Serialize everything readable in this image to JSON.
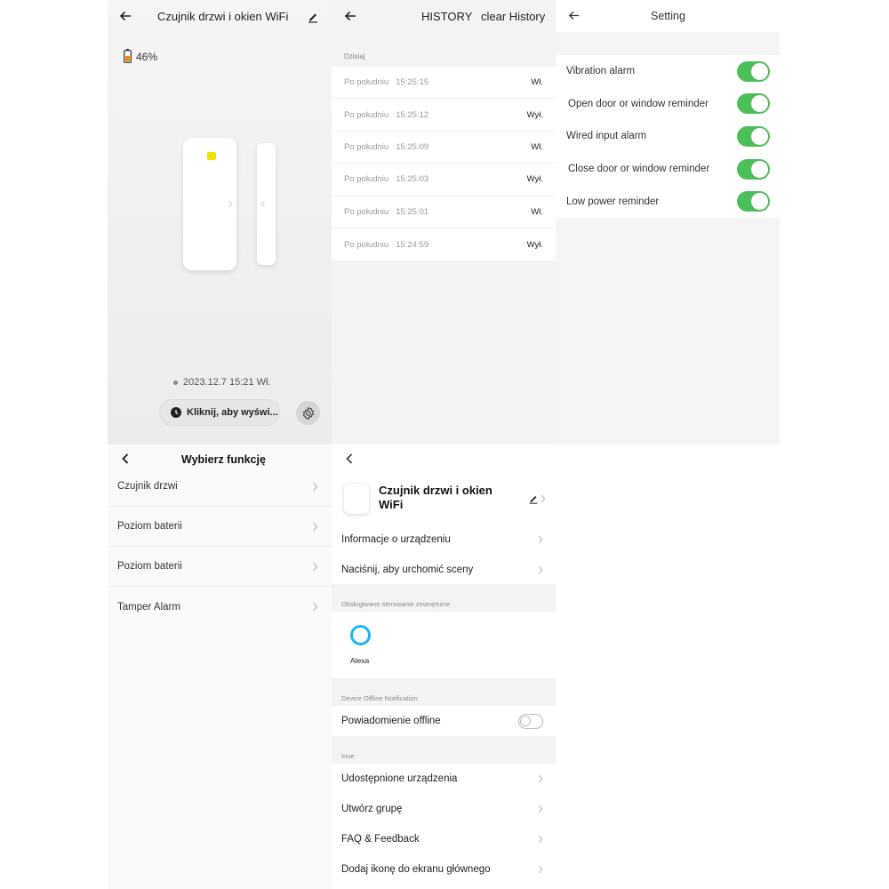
{
  "screen_device": {
    "title": "Czujnik drzwi i okien WiFi",
    "battery": "46%",
    "last_status": "2023.12.7 15:21 Wł.",
    "history_button": "Kliknij, aby wyświ..."
  },
  "screen_history": {
    "title": "HISTORY",
    "clear_label": "clear History",
    "section": "Dzisiaj",
    "records": [
      {
        "period": "Po południu",
        "time": "15:25:15",
        "state": "Wł."
      },
      {
        "period": "Po południu",
        "time": "15:25:12",
        "state": "Wył."
      },
      {
        "period": "Po południu",
        "time": "15:25:09",
        "state": "Wł."
      },
      {
        "period": "Po południu",
        "time": "15:25:03",
        "state": "Wył."
      },
      {
        "period": "Po południu",
        "time": "15:25:01",
        "state": "Wł."
      },
      {
        "period": "Po południu",
        "time": "15:24:59",
        "state": "Wył."
      }
    ]
  },
  "screen_setting": {
    "title": "Setting",
    "options": [
      {
        "label": "Vibration alarm",
        "enabled": true
      },
      {
        "label": "Open door or window reminder",
        "enabled": true
      },
      {
        "label": "Wired input alarm",
        "enabled": true
      },
      {
        "label": "Close door or window reminder",
        "enabled": true
      },
      {
        "label": "Low power reminder",
        "enabled": true
      }
    ]
  },
  "screen_functions": {
    "title": "Wybierz funkcję",
    "items": [
      "Czujnik drzwi",
      "Poziom baterii",
      "Poziom baterii",
      "Tamper Alarm"
    ]
  },
  "screen_details": {
    "device_name": "Czujnik drzwi i okien WiFi",
    "info": "Informacje o urządzeniu",
    "scene": "Naciśnij, aby urchomić sceny",
    "external_section": "Obsługiwane sterowanie zewnętrzne",
    "alexa": "Alexa",
    "offline_section": "Device Offline Notification",
    "offline_label": "Powiadomienie offline",
    "offline_enabled": false,
    "other_section": "Inne",
    "other_items": [
      "Udostępnione urządzenia",
      "Utwórz grupę",
      "FAQ & Feedback",
      "Dodaj ikonę do ekranu głównego"
    ]
  },
  "colors": {
    "toggle_on": "#4cbe5a",
    "alexa_blue": "#1bb7e8",
    "led_yellow": "#f2e200",
    "battery_orange": "#f08c00"
  }
}
